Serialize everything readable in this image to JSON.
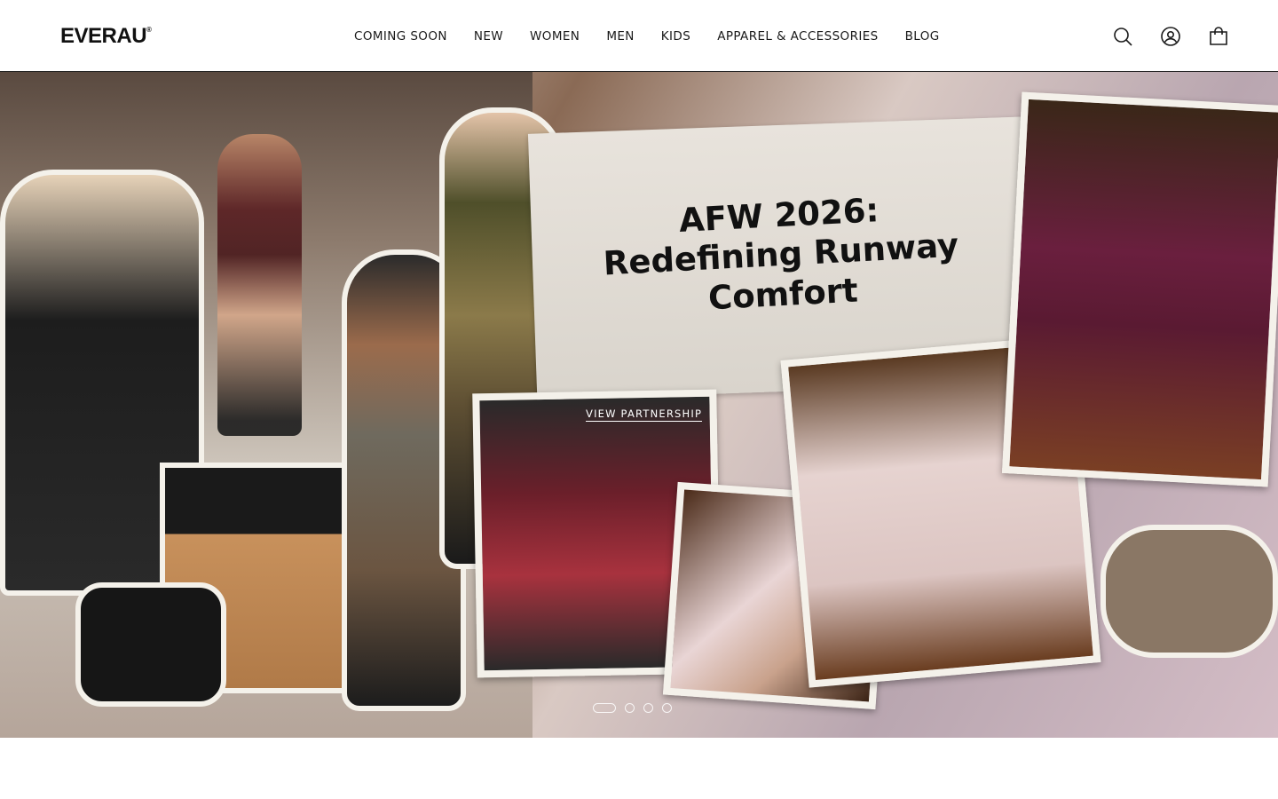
{
  "brand": {
    "name": "EVERAU",
    "mark": "®"
  },
  "nav": {
    "items": [
      {
        "label": "COMING SOON"
      },
      {
        "label": "NEW"
      },
      {
        "label": "WOMEN"
      },
      {
        "label": "MEN"
      },
      {
        "label": "KIDS"
      },
      {
        "label": "APPAREL & ACCESSORIES"
      },
      {
        "label": "BLOG"
      }
    ]
  },
  "header_icons": [
    "search-icon",
    "account-icon",
    "cart-icon"
  ],
  "hero": {
    "title_lines": [
      "AFW 2026:",
      "Redefining Runway",
      "Comfort"
    ],
    "cta": "VIEW PARTNERSHIP",
    "slides_total": 4,
    "active_slide": 1
  }
}
